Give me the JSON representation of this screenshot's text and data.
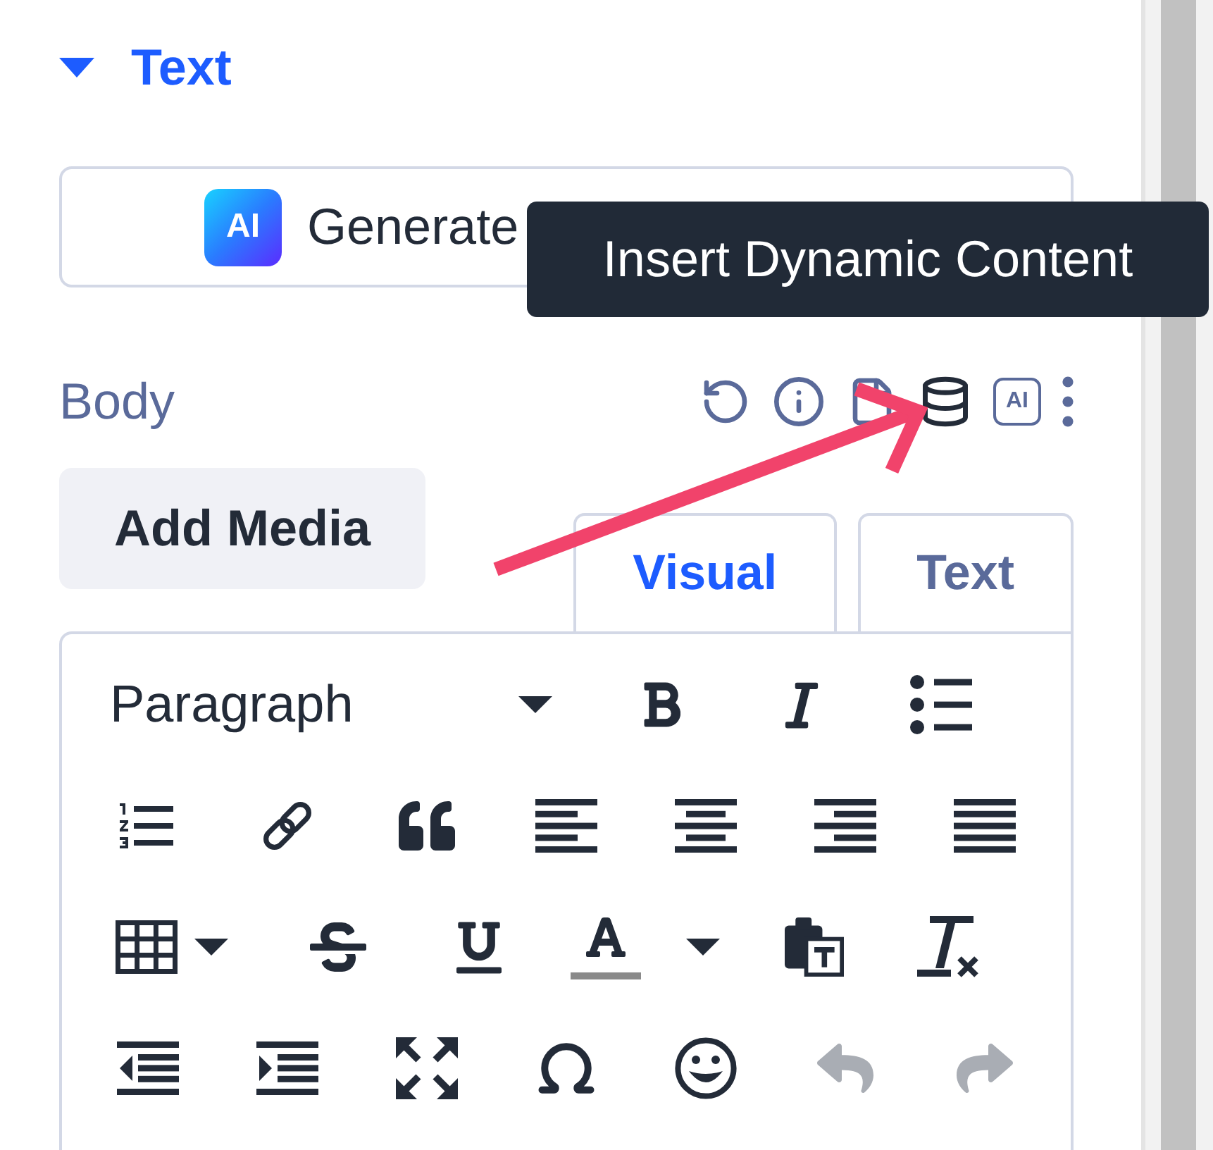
{
  "section": {
    "title": "Text",
    "expanded": true
  },
  "generate_button": {
    "logo_text": "AI",
    "label": "Generate"
  },
  "tooltip": {
    "text": "Insert Dynamic Content"
  },
  "body_field": {
    "label": "Body",
    "actions": [
      {
        "kind": "reset",
        "active": false
      },
      {
        "kind": "info",
        "active": false
      },
      {
        "kind": "document",
        "active": false
      },
      {
        "kind": "dynamic_content",
        "active": true
      },
      {
        "kind": "ai",
        "text": "AI",
        "active": false
      },
      {
        "kind": "more",
        "active": false
      }
    ]
  },
  "add_media_button": {
    "label": "Add Media"
  },
  "editor_tabs": [
    {
      "label": "Visual",
      "selected": true
    },
    {
      "label": "Text",
      "selected": false
    }
  ],
  "toolbar": {
    "rows": [
      [
        {
          "kind": "format_select",
          "value": "Paragraph",
          "disabled": false
        },
        {
          "kind": "bold",
          "disabled": false
        },
        {
          "kind": "italic",
          "disabled": false
        },
        {
          "kind": "bullet_list",
          "disabled": false
        }
      ],
      [
        {
          "kind": "numbered_list",
          "disabled": false
        },
        {
          "kind": "link",
          "disabled": false
        },
        {
          "kind": "blockquote",
          "disabled": false
        },
        {
          "kind": "align_left",
          "disabled": false
        },
        {
          "kind": "align_center",
          "disabled": false
        },
        {
          "kind": "align_right",
          "disabled": false
        },
        {
          "kind": "align_justify",
          "disabled": false
        }
      ],
      [
        {
          "kind": "table",
          "disabled": false
        },
        {
          "kind": "strikethrough",
          "disabled": false
        },
        {
          "kind": "underline",
          "disabled": false
        },
        {
          "kind": "text_color",
          "disabled": false
        },
        {
          "kind": "paste_text",
          "disabled": false
        },
        {
          "kind": "clear_formatting",
          "disabled": false
        }
      ],
      [
        {
          "kind": "outdent",
          "disabled": false
        },
        {
          "kind": "indent",
          "disabled": false
        },
        {
          "kind": "fullscreen",
          "disabled": false
        },
        {
          "kind": "special_character",
          "disabled": false
        },
        {
          "kind": "emoji",
          "disabled": false
        },
        {
          "kind": "undo",
          "disabled": true
        },
        {
          "kind": "redo",
          "disabled": true
        }
      ]
    ]
  }
}
